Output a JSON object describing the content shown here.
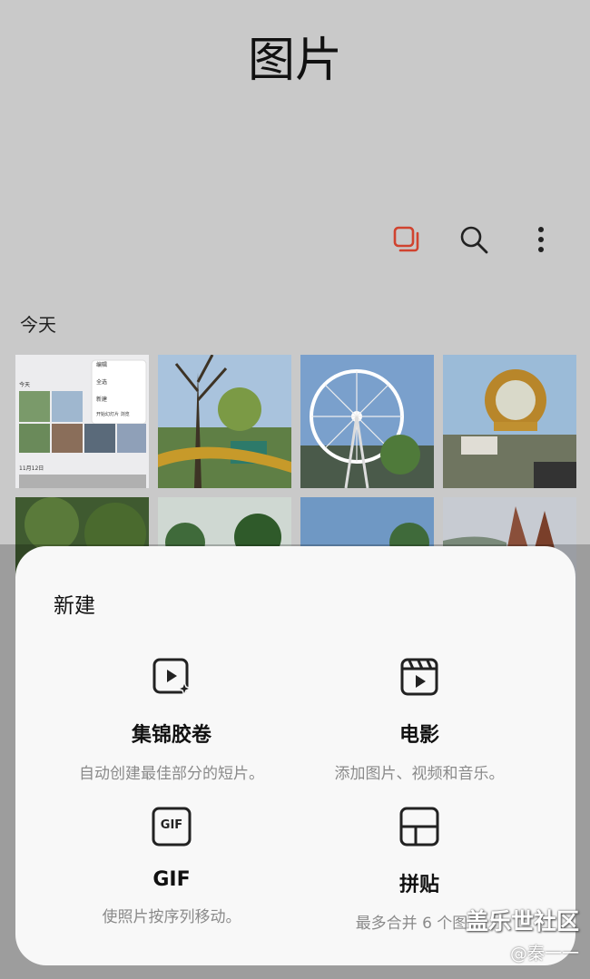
{
  "page": {
    "title": "图片"
  },
  "toolbar": {
    "items": [
      {
        "icon": "select-album-icon",
        "accent": "#d0432f"
      },
      {
        "icon": "search-icon"
      },
      {
        "icon": "more-options-icon"
      }
    ]
  },
  "gallery": {
    "section_label": "今天",
    "screenshot_thumb": {
      "menu_items": [
        "编辑",
        "全选",
        "新建",
        "开始幻灯片 浏览"
      ],
      "header": "今天",
      "date": "11月12日"
    }
  },
  "sheet": {
    "title": "新建",
    "options": [
      {
        "label": "集锦胶卷",
        "desc": "自动创建最佳部分的短片。",
        "icon": "highlight-reel-icon"
      },
      {
        "label": "电影",
        "desc": "添加图片、视频和音乐。",
        "icon": "movie-icon"
      },
      {
        "label": "GIF",
        "desc": "使照片按序列移动。",
        "icon": "gif-icon",
        "icon_text": "GIF"
      },
      {
        "label": "拼贴",
        "desc": "最多合并 6 个图片",
        "icon": "collage-icon"
      }
    ]
  },
  "watermark": {
    "main": "盖乐世社区",
    "sub": "@秦一一"
  }
}
